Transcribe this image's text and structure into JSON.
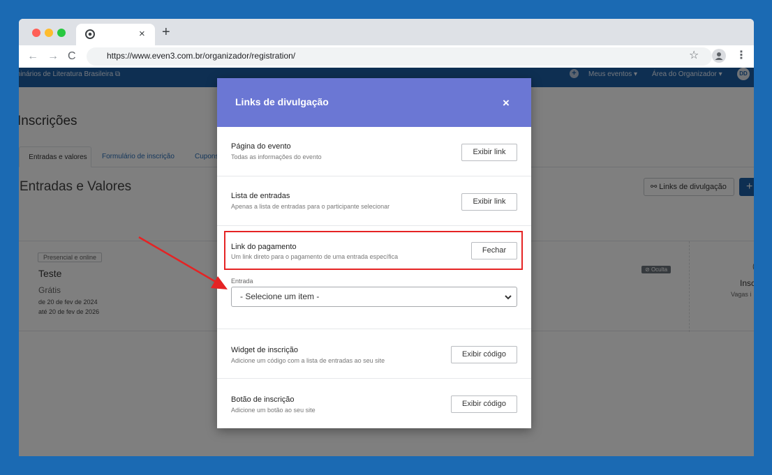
{
  "browser": {
    "url": "https://www.even3.com.br/organizador/registration/",
    "tab_close": "×",
    "new_tab": "+",
    "back": "←",
    "forward": "→",
    "reload": "C",
    "star": "☆",
    "menu": "⋮"
  },
  "app_header": {
    "event_name": "minários de Literatura Brasileira",
    "my_events": "Meus eventos ▾",
    "organizer_area": "Área do Organizador ▾",
    "avatar": "DD",
    "plus": "+"
  },
  "page": {
    "title": "Inscrições",
    "tabs": [
      "Entradas e valores",
      "Formulário de inscrição",
      "Cupons"
    ],
    "section_title": "Entradas e Valores",
    "share_button": "Links de divulgação",
    "add_button": "+"
  },
  "ticket": {
    "badge": "Presencial e online",
    "name": "Teste",
    "price": "Grátis",
    "date_from": "de 20 de fev de 2024",
    "date_to": "até 20 de fev de 2026",
    "hidden_badge": "Oculta",
    "inscriptions": "Insc",
    "vacancies": "Vagas i",
    "circle_fragment": "("
  },
  "modal": {
    "title": "Links de divulgação",
    "close": "×",
    "rows": [
      {
        "title": "Página do evento",
        "desc": "Todas as informações do evento",
        "button": "Exibir link"
      },
      {
        "title": "Lista de entradas",
        "desc": "Apenas a lista de entradas para o participante selecionar",
        "button": "Exibir link"
      },
      {
        "title": "Link do pagamento",
        "desc": "Um link direto para o pagamento de uma entrada específica",
        "button": "Fechar"
      },
      {
        "title": "Widget de inscrição",
        "desc": "Adicione um código com a lista de entradas ao seu site",
        "button": "Exibir código"
      },
      {
        "title": "Botão de inscrição",
        "desc": "Adicione um botão ao seu site",
        "button": "Exibir código"
      }
    ],
    "entrada_label": "Entrada",
    "entrada_select": "- Selecione um item -"
  },
  "annotation": {
    "highlight_color": "#e52324",
    "arrow_color": "#e52324"
  },
  "colors": {
    "background": "#1b6ab3",
    "app_header": "#1c5fa5",
    "modal_header": "#6b77d4"
  }
}
